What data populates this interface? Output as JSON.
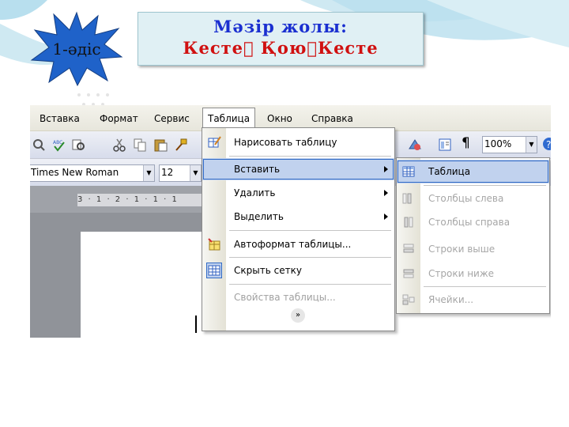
{
  "slide": {
    "badge_label": "1-әдіс",
    "title_line1": "Мәзір жолы:",
    "title_line2": "Кесте ҚоюКесте",
    "colors": {
      "badge": "#1f62c9",
      "title_blue": "#1a2fd0",
      "title_red": "#d01010"
    }
  },
  "menubar": {
    "items": [
      "Вставка",
      "Формат",
      "Сервис",
      "Таблица",
      "Окно",
      "Справка"
    ],
    "active": "Таблица"
  },
  "toolbar": {
    "zoom": "100%",
    "pilcrow": "¶",
    "font_name": "Times New Roman",
    "font_size": "12"
  },
  "ruler": {
    "text": "3 · 1 · 2 · 1 · 1 · 1"
  },
  "table_menu": {
    "items": [
      {
        "label": "Нарисовать таблицу",
        "icon": "draw-table-icon"
      },
      {
        "label": "Вставить",
        "submenu": true,
        "highlighted": true
      },
      {
        "label": "Удалить",
        "submenu": true
      },
      {
        "label": "Выделить",
        "submenu": true
      },
      {
        "label": "Автоформат таблицы...",
        "icon": "autoformat-icon"
      },
      {
        "label": "Скрыть сетку",
        "icon": "grid-icon"
      },
      {
        "label": "Свойства таблицы...",
        "disabled": true
      }
    ],
    "more": "»"
  },
  "insert_submenu": {
    "items": [
      {
        "label": "Таблица",
        "icon": "table-icon",
        "highlighted": true
      },
      {
        "label": "Столбцы слева",
        "icon": "columns-left-icon",
        "disabled": true
      },
      {
        "label": "Столбцы справа",
        "icon": "columns-right-icon",
        "disabled": true
      },
      {
        "label": "Строки выше",
        "icon": "rows-above-icon",
        "disabled": true
      },
      {
        "label": "Строки ниже",
        "icon": "rows-below-icon",
        "disabled": true
      },
      {
        "label": "Ячейки...",
        "icon": "cells-icon",
        "disabled": true
      }
    ]
  }
}
